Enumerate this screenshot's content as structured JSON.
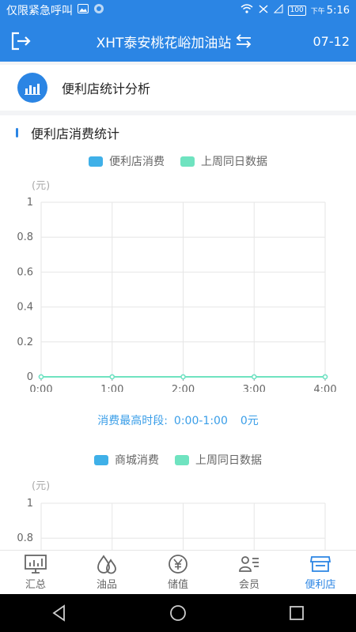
{
  "status_bar": {
    "left_text": "仅限紧急呼叫",
    "battery": "100",
    "time_prefix": "下午",
    "time": "5:16"
  },
  "header": {
    "title": "XHT泰安桃花峪加油站",
    "date": "07-12"
  },
  "section": {
    "title": "便利店统计分析"
  },
  "chart1": {
    "heading": "便利店消费统计",
    "legend": [
      "便利店消费",
      "上周同日数据"
    ],
    "unit": "(元)"
  },
  "peak": {
    "label": "消费最高时段:",
    "range": "0:00-1:00",
    "value": "0元"
  },
  "chart2": {
    "legend": [
      "商城消费",
      "上周同日数据"
    ],
    "unit": "(元)"
  },
  "colors": {
    "primary": "#2b85e4",
    "series_current": "#3fb0e8",
    "series_lastweek": "#6fe3c0",
    "grid": "#e6e6e6"
  },
  "chart_data": [
    {
      "type": "line",
      "x": [
        "0:00",
        "1:00",
        "2:00",
        "3:00",
        "4:00"
      ],
      "series": [
        {
          "name": "便利店消费",
          "values": [
            0,
            0,
            0,
            0,
            0
          ]
        },
        {
          "name": "上周同日数据",
          "values": [
            0,
            0,
            0,
            0,
            0
          ]
        }
      ],
      "yticks": [
        "1",
        "0.8",
        "0.6",
        "0.4",
        "0.2",
        "0"
      ],
      "ylim": [
        0,
        1
      ],
      "ylabel": "(元)",
      "grid": true,
      "legend": "top-center"
    },
    {
      "type": "line",
      "series": [
        {
          "name": "商城消费",
          "values": []
        },
        {
          "name": "上周同日数据",
          "values": []
        }
      ],
      "yticks": [
        "1",
        "0.8"
      ],
      "ylim": [
        0,
        1
      ],
      "ylabel": "(元)",
      "grid": true,
      "legend": "top-center"
    }
  ],
  "tabs": [
    {
      "label": "汇总",
      "icon": "monitor-icon"
    },
    {
      "label": "油品",
      "icon": "oil-drop-icon"
    },
    {
      "label": "储值",
      "icon": "yen-coin-icon"
    },
    {
      "label": "会员",
      "icon": "member-card-icon"
    },
    {
      "label": "便利店",
      "icon": "store-icon",
      "active": true
    }
  ]
}
